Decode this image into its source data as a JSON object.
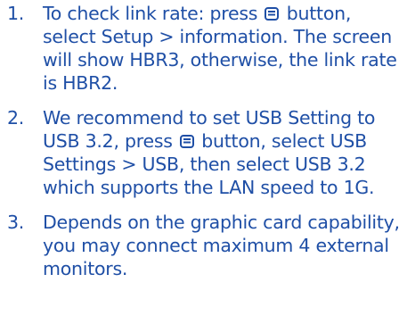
{
  "colors": {
    "text": "#1f4fa6"
  },
  "icons": {
    "menu_button": "menu-button-icon"
  },
  "notes": [
    {
      "number": "1.",
      "text_before": "To check link rate: press",
      "text_after": "button, select Setup > information. The screen will show HBR3, otherwise, the link rate is HBR2."
    },
    {
      "number": "2.",
      "text_before": "We recommend to set USB Setting to USB 3.2, press",
      "text_after": "button, select USB Settings > USB, then select USB 3.2 which supports the LAN speed to 1G."
    },
    {
      "number": "3.",
      "text": "Depends on the graphic card capability, you may connect maximum 4 external monitors."
    }
  ]
}
